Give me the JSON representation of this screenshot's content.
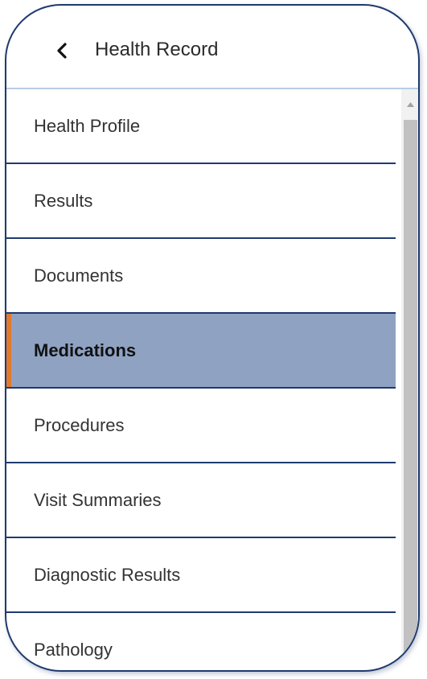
{
  "header": {
    "title": "Health Record",
    "back_icon": "chevron-left-icon"
  },
  "nav": {
    "items": [
      {
        "label": "Health Profile",
        "active": false
      },
      {
        "label": "Results",
        "active": false
      },
      {
        "label": "Documents",
        "active": false
      },
      {
        "label": "Medications",
        "active": true
      },
      {
        "label": "Procedures",
        "active": false
      },
      {
        "label": "Visit Summaries",
        "active": false
      },
      {
        "label": "Diagnostic Results",
        "active": false
      },
      {
        "label": "Pathology",
        "active": false
      }
    ]
  },
  "colors": {
    "border": "#1f3a6e",
    "active_background": "#8fa2c2",
    "active_indicator": "#e07a2e",
    "header_divider": "#b9cde4"
  }
}
